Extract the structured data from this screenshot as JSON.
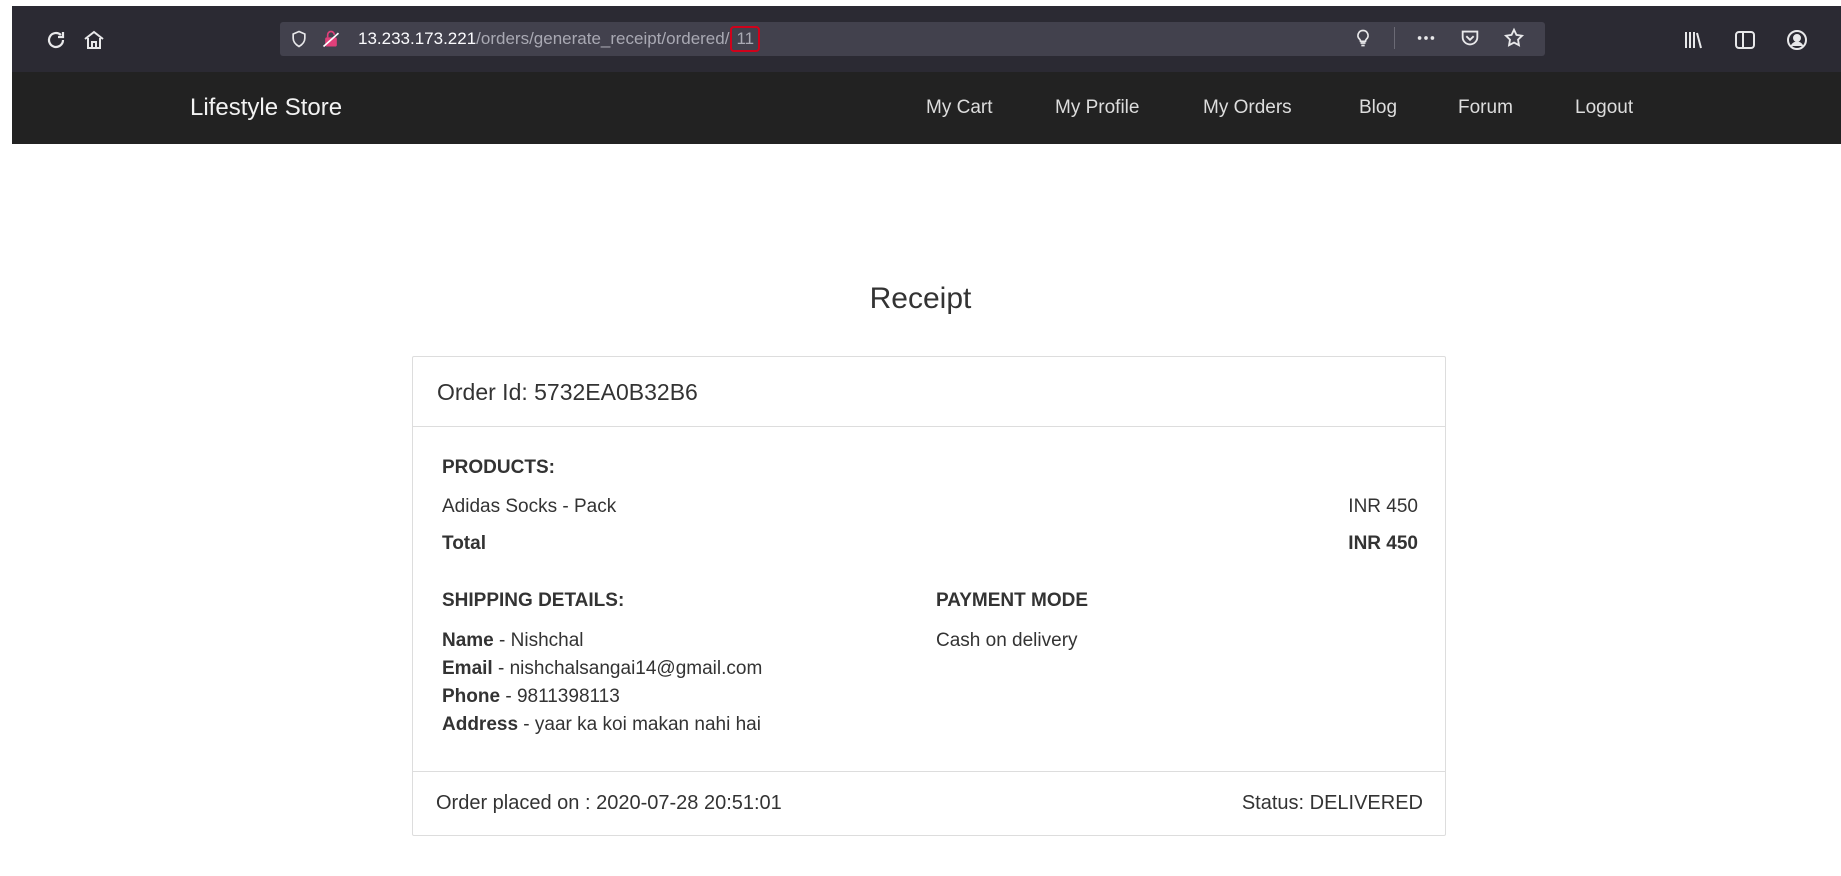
{
  "browser": {
    "url_host": "13.233.173.221",
    "url_path": "/orders/generate_receipt/ordered/",
    "url_id": "11"
  },
  "navbar": {
    "brand": "Lifestyle Store",
    "links": [
      "My Cart",
      "My Profile",
      "My Orders",
      "Blog",
      "Forum",
      "Logout"
    ]
  },
  "page": {
    "heading": "Receipt"
  },
  "receipt": {
    "order_id_label": "Order Id: 5732EA0B32B6",
    "products_label": "PRODUCTS:",
    "items": [
      {
        "name": "Adidas Socks - Pack",
        "price": "INR 450"
      }
    ],
    "total_label": "Total",
    "total_value": "INR 450",
    "shipping_label": "SHIPPING DETAILS:",
    "shipping": {
      "name_label": "Name",
      "name_value": " - Nishchal",
      "email_label": "Email",
      "email_value": " - nishchalsangai14@gmail.com",
      "phone_label": "Phone",
      "phone_value": " - 9811398113",
      "address_label": "Address",
      "address_value": " - yaar ka koi makan nahi hai"
    },
    "payment_label": "PAYMENT MODE",
    "payment_value": "Cash on delivery",
    "order_placed": "Order placed on : 2020-07-28 20:51:01",
    "status": "Status: DELIVERED"
  },
  "icons": [
    "reload-icon",
    "home-icon",
    "shield-icon",
    "insecure-lock-icon",
    "lightbulb-icon",
    "more-icon",
    "pocket-icon",
    "bookmark-star-icon",
    "library-icon",
    "sidebar-icon",
    "account-icon"
  ],
  "colors": {
    "chrome": "#2b2a33",
    "urlbar": "#42414d",
    "navbar": "#222222",
    "highlight": "#d0021b"
  }
}
